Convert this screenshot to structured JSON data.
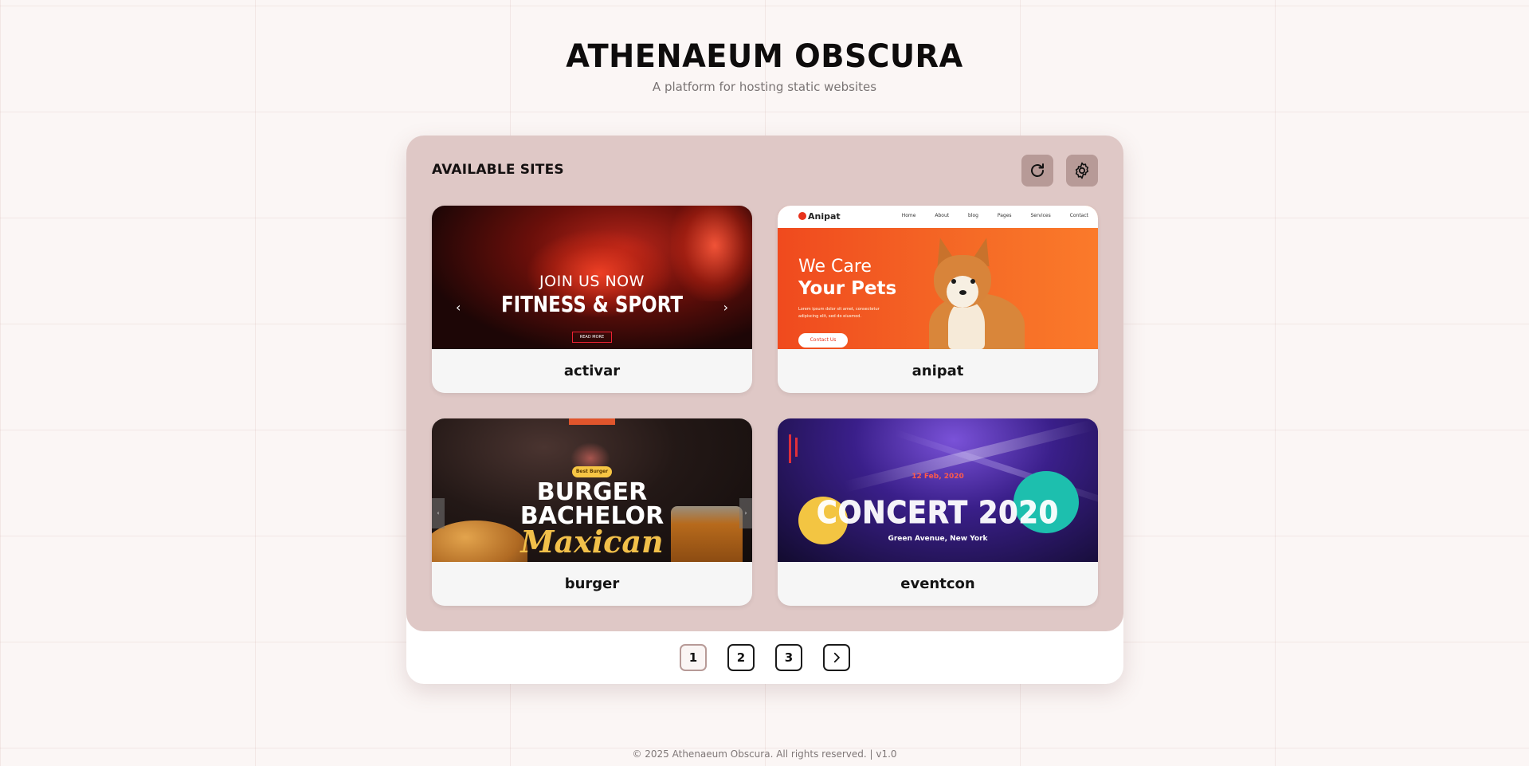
{
  "header": {
    "title": "ATHENAEUM OBSCURA",
    "subtitle": "A platform for hosting static websites"
  },
  "panel": {
    "title": "AVAILABLE SITES",
    "refresh_icon": "refresh-icon",
    "settings_icon": "gear-icon"
  },
  "sites": [
    {
      "name": "activar",
      "thumb": {
        "line1": "JOIN US NOW",
        "line2": "FITNESS & SPORT",
        "button": "READ MORE"
      }
    },
    {
      "name": "anipat",
      "thumb": {
        "logo": "Anipat",
        "nav": "Home About blog Pages Services Contact",
        "line1": "We Care",
        "line2": "Your Pets",
        "small": "Lorem ipsum dolor sit amet, consectetur adipiscing elit, sed do eiusmod.",
        "button": "Contact Us"
      }
    },
    {
      "name": "burger",
      "thumb": {
        "badge": "Best Burger",
        "line1": "BURGER",
        "line2": "BACHELOR",
        "line3": "Maxican"
      }
    },
    {
      "name": "eventcon",
      "thumb": {
        "date": "12 Feb, 2020",
        "line1": "CONCERT 2020",
        "address": "Green Avenue, New York"
      }
    }
  ],
  "pagination": {
    "pages": [
      "1",
      "2",
      "3"
    ],
    "current": "1",
    "next_icon": "chevron-right-icon"
  },
  "footer": {
    "text": "© 2025 Athenaeum Obscura. All rights reserved. | v1.0"
  },
  "colors": {
    "panel_bg": "#dfc8c6",
    "button_bg": "#b79a97",
    "page_bg": "#fbf6f5"
  }
}
